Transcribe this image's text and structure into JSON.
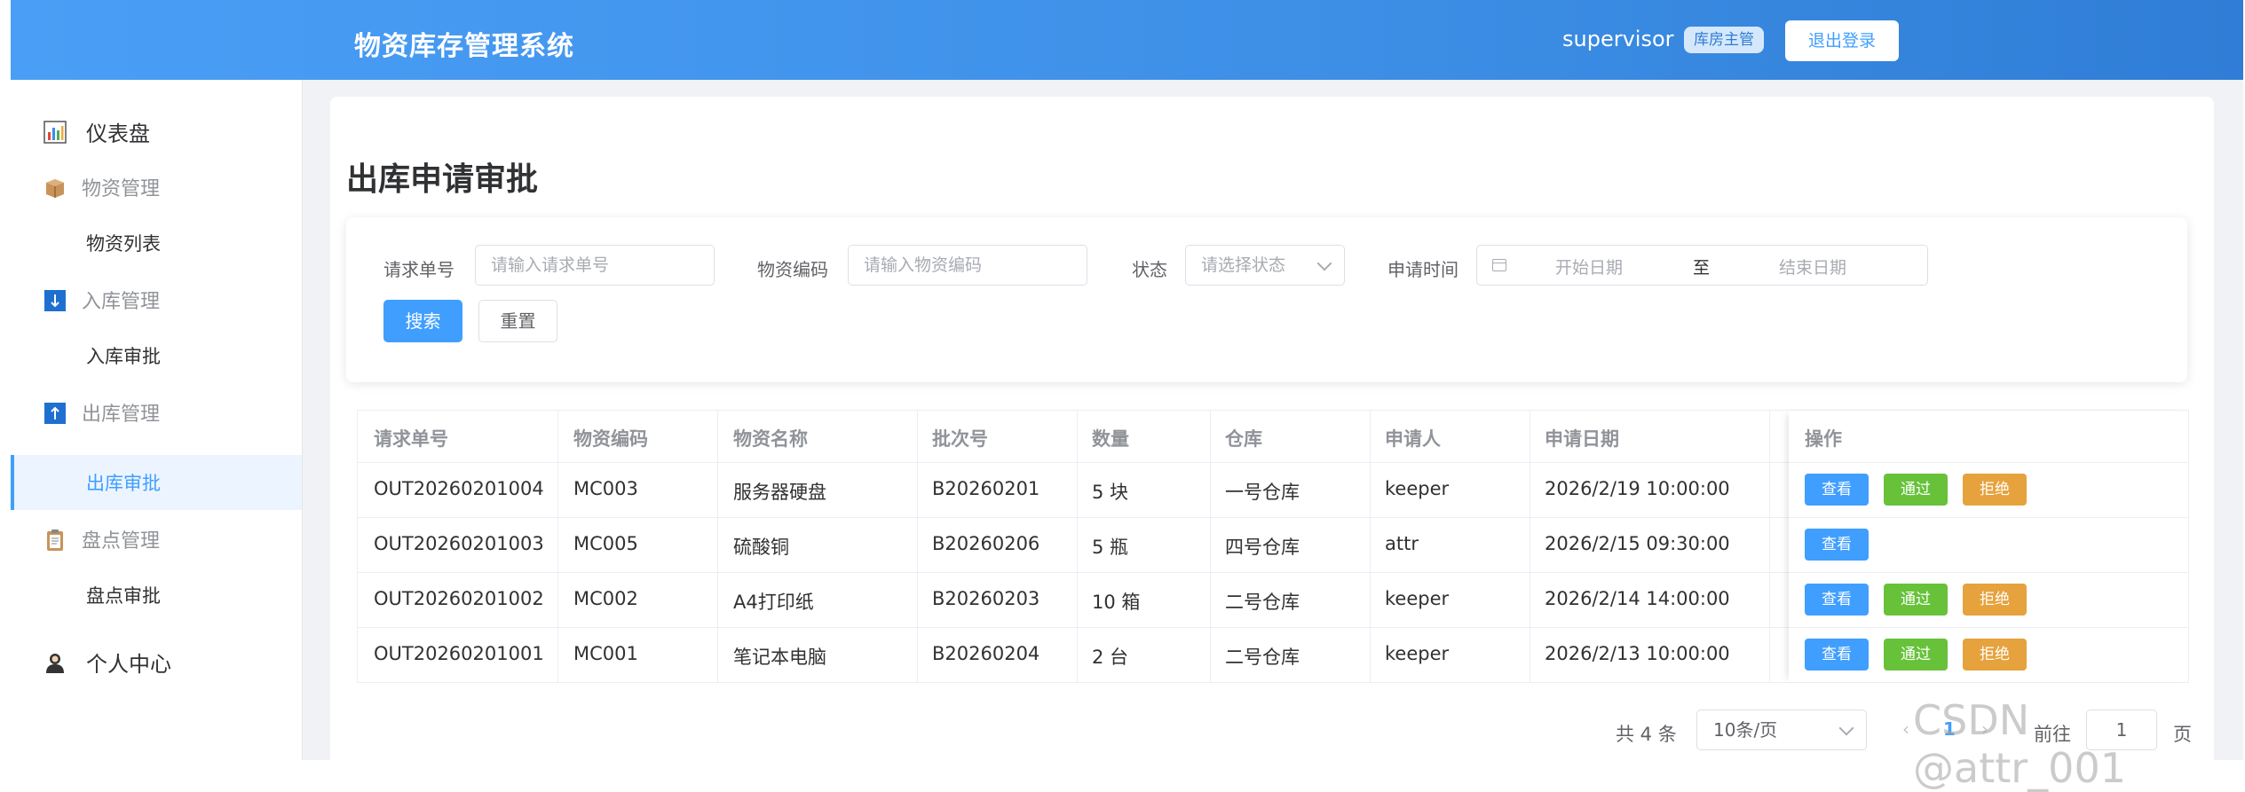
{
  "header": {
    "app_title": "物资库存管理系统",
    "username": "supervisor",
    "role": "库房主管",
    "logout_label": "退出登录"
  },
  "sidebar": {
    "items": [
      {
        "label": "仪表盘",
        "icon": "bar-chart-icon"
      },
      {
        "label": "物资管理",
        "icon": "box-icon"
      },
      {
        "label": "物资列表"
      },
      {
        "label": "入库管理",
        "icon": "down-arrow-icon"
      },
      {
        "label": "入库审批"
      },
      {
        "label": "出库管理",
        "icon": "up-arrow-icon"
      },
      {
        "label": "出库审批",
        "active": true
      },
      {
        "label": "盘点管理",
        "icon": "clipboard-icon"
      },
      {
        "label": "盘点审批"
      },
      {
        "label": "个人中心",
        "icon": "user-icon"
      }
    ]
  },
  "page": {
    "title": "出库申请审批"
  },
  "filters": {
    "request_no_label": "请求单号",
    "request_no_placeholder": "请输入请求单号",
    "material_code_label": "物资编码",
    "material_code_placeholder": "请输入物资编码",
    "status_label": "状态",
    "status_placeholder": "请选择状态",
    "apply_time_label": "申请时间",
    "start_date_placeholder": "开始日期",
    "range_separator": "至",
    "end_date_placeholder": "结束日期",
    "search_label": "搜索",
    "reset_label": "重置"
  },
  "table": {
    "columns": [
      "请求单号",
      "物资编码",
      "物资名称",
      "批次号",
      "数量",
      "仓库",
      "申请人",
      "申请日期",
      "操作"
    ],
    "rows": [
      {
        "request_no": "OUT20260201004",
        "code": "MC003",
        "name": "服务器硬盘",
        "batch": "B20260201",
        "qty": "5 块",
        "warehouse": "一号仓库",
        "applicant": "keeper",
        "date": "2026/2/19 10:00:00"
      },
      {
        "request_no": "OUT20260201003",
        "code": "MC005",
        "name": "硫酸铜",
        "batch": "B20260206",
        "qty": "5 瓶",
        "warehouse": "四号仓库",
        "applicant": "attr",
        "date": "2026/2/15 09:30:00"
      },
      {
        "request_no": "OUT20260201002",
        "code": "MC002",
        "name": "A4打印纸",
        "batch": "B20260203",
        "qty": "10 箱",
        "warehouse": "二号仓库",
        "applicant": "keeper",
        "date": "2026/2/14 14:00:00"
      },
      {
        "request_no": "OUT20260201001",
        "code": "MC001",
        "name": "笔记本电脑",
        "batch": "B20260204",
        "qty": "2 台",
        "warehouse": "二号仓库",
        "applicant": "keeper",
        "date": "2026/2/13 10:00:00"
      }
    ],
    "actions": {
      "view": "查看",
      "pass": "通过",
      "reject": "拒绝"
    }
  },
  "pagination": {
    "total_text": "共 4 条",
    "page_size": "10条/页",
    "current_page": "1",
    "goto_label": "前往",
    "goto_value": "1",
    "page_suffix": "页"
  },
  "watermark": "CSDN @attr_001",
  "colors": {
    "primary": "#409eff",
    "success": "#67c23a",
    "warning": "#e6a23c",
    "header_gradient_start": "#4a9ef5",
    "header_gradient_end": "#2f7dd6"
  }
}
